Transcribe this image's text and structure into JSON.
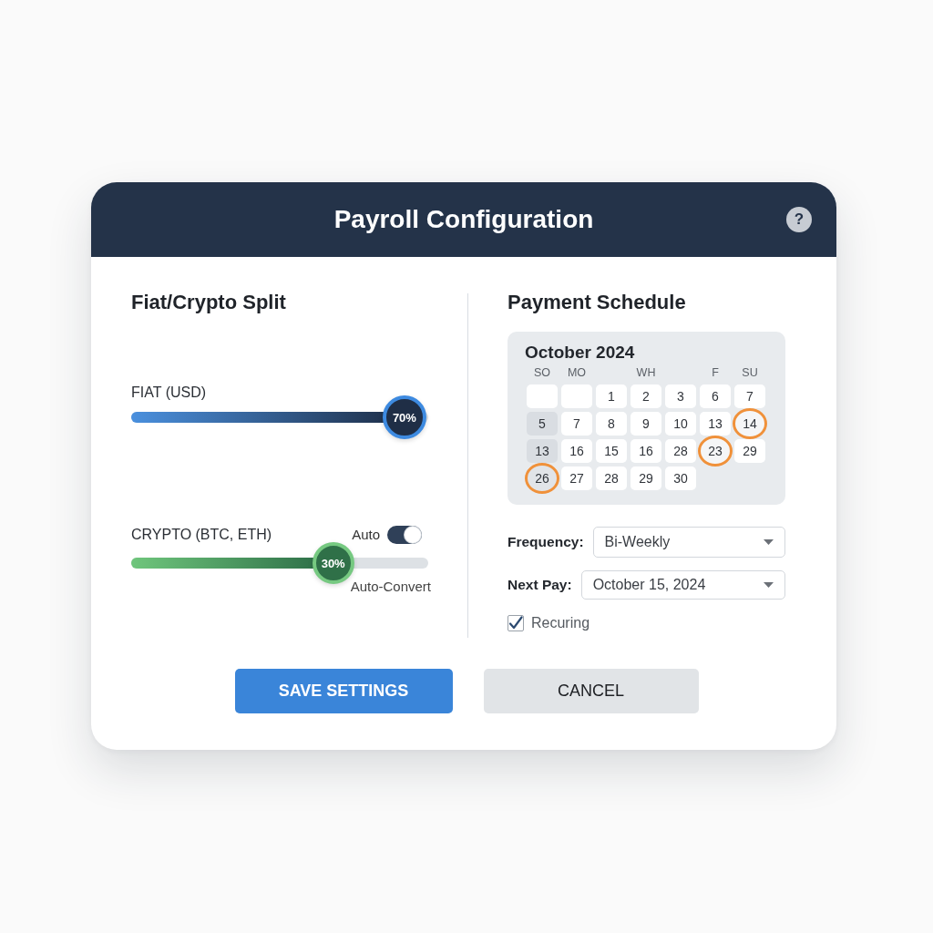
{
  "window": {
    "title": "Payroll Configuration",
    "help": "?"
  },
  "split": {
    "title": "Fiat/Crypto Split",
    "sliders": [
      {
        "kind": "fiat",
        "label": "FIAT (USD)",
        "level": 0.92,
        "reading": "70%"
      },
      {
        "kind": "crypto",
        "label": "CRYPTO (BTC, ETH)",
        "level": 0.68,
        "reading": "30%",
        "toggle": {
          "label": "Auto",
          "on": true
        },
        "caption": "Auto-Convert"
      }
    ]
  },
  "schedule": {
    "title": "Payment Schedule",
    "calendar": {
      "month": "October 2024",
      "weekdays": [
        {
          "kind": "label",
          "label": "SO"
        },
        {
          "kind": "label",
          "label": "MO"
        },
        {
          "kind": "gap"
        },
        {
          "kind": "label",
          "label": "WH"
        },
        {
          "kind": "gap"
        },
        {
          "kind": "label",
          "label": "F"
        },
        {
          "kind": "label",
          "label": "SU"
        }
      ],
      "rows": [
        [
          {
            "kind": "empty",
            "circled": false
          },
          {
            "kind": "empty",
            "circled": false
          },
          {
            "kind": "day",
            "label": "1",
            "circled": false
          },
          {
            "kind": "day",
            "label": "2",
            "circled": false
          },
          {
            "kind": "day",
            "label": "3",
            "circled": false
          },
          {
            "kind": "day",
            "label": "6",
            "circled": false
          },
          {
            "kind": "day",
            "label": "7",
            "circled": false
          }
        ],
        [
          {
            "kind": "shaded",
            "label": "5",
            "circled": false
          },
          {
            "kind": "day",
            "label": "7",
            "circled": false
          },
          {
            "kind": "day",
            "label": "8",
            "circled": false
          },
          {
            "kind": "day",
            "label": "9",
            "circled": false
          },
          {
            "kind": "day",
            "label": "10",
            "circled": false
          },
          {
            "kind": "day",
            "label": "13",
            "circled": false
          },
          {
            "kind": "day",
            "label": "14",
            "circled": true
          }
        ],
        [
          {
            "kind": "shaded",
            "label": "13",
            "circled": false
          },
          {
            "kind": "day",
            "label": "16",
            "circled": false
          },
          {
            "kind": "day",
            "label": "15",
            "circled": false
          },
          {
            "kind": "day",
            "label": "16",
            "circled": false
          },
          {
            "kind": "day",
            "label": "28",
            "circled": false
          },
          {
            "kind": "day",
            "label": "23",
            "circled": true
          },
          {
            "kind": "day",
            "label": "29",
            "circled": false
          }
        ],
        [
          {
            "kind": "shaded",
            "label": "26",
            "circled": true
          },
          {
            "kind": "day",
            "label": "27",
            "circled": false
          },
          {
            "kind": "day",
            "label": "28",
            "circled": false
          },
          {
            "kind": "day",
            "label": "29",
            "circled": false
          },
          {
            "kind": "day",
            "label": "30",
            "circled": false
          }
        ]
      ]
    },
    "fields": [
      {
        "label": "Frequency:",
        "value": "Bi-Weekly"
      },
      {
        "label": "Next Pay:",
        "value": "October 15, 2024"
      }
    ],
    "recurring": {
      "label": "Recuring",
      "checked": true
    }
  },
  "buttons": [
    {
      "kind": "primary",
      "label": "SAVE SETTINGS"
    },
    {
      "kind": "secondary",
      "label": "CANCEL"
    }
  ]
}
